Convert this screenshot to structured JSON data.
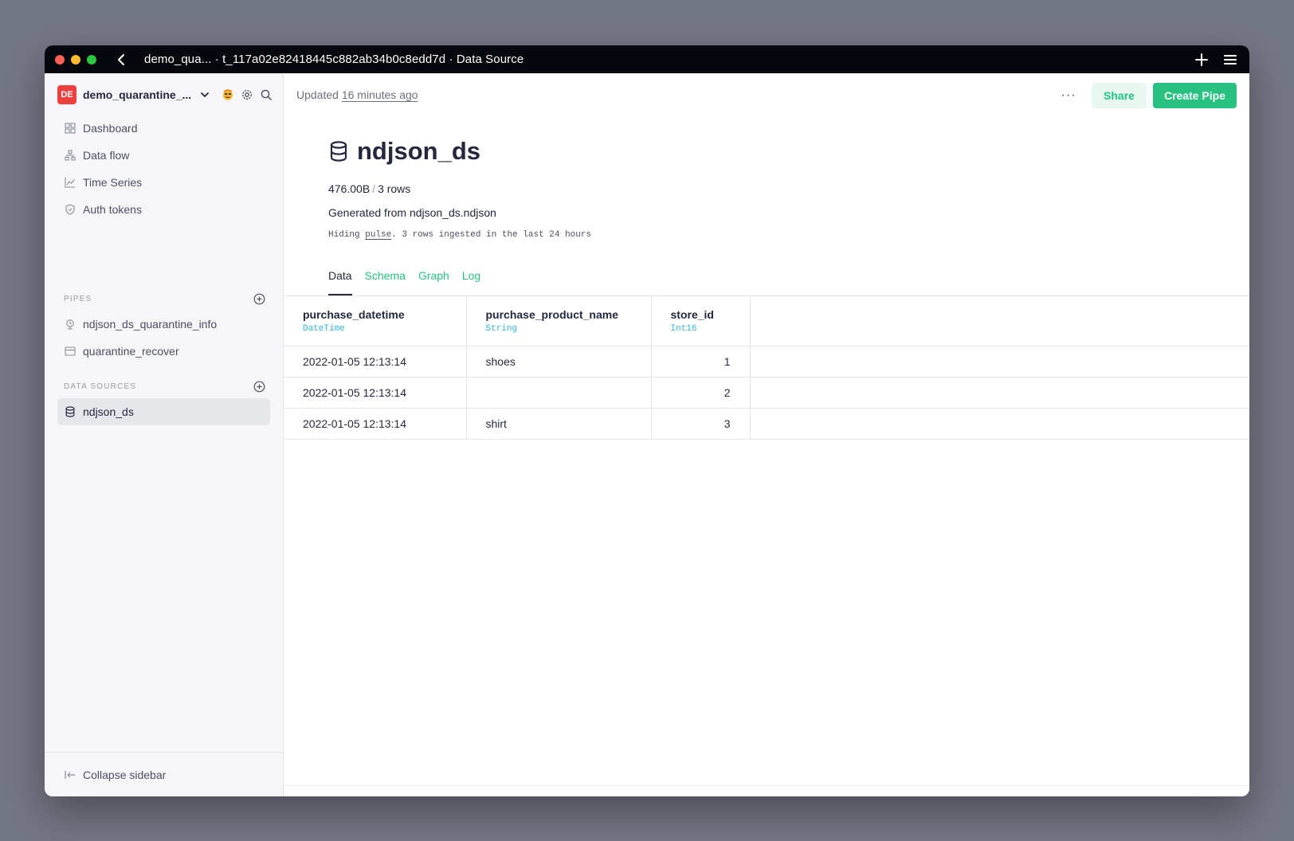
{
  "window": {
    "title": "demo_qua... · t_117a02e82418445c882ab34b0c8edd7d · Data Source"
  },
  "sidebar": {
    "workspace_badge": "DE",
    "workspace_name": "demo_quarantine_...",
    "nav": [
      {
        "label": "Dashboard",
        "icon": "dashboard-icon"
      },
      {
        "label": "Data flow",
        "icon": "data-flow-icon"
      },
      {
        "label": "Time Series",
        "icon": "chart-icon"
      },
      {
        "label": "Auth tokens",
        "icon": "shield-icon"
      }
    ],
    "pipes_heading": "PIPES",
    "pipes": [
      {
        "label": "ndjson_ds_quarantine_info",
        "icon": "pipe-endpoint-icon"
      },
      {
        "label": "quarantine_recover",
        "icon": "pipe-icon"
      }
    ],
    "datasources_heading": "DATA SOURCES",
    "datasources": [
      {
        "label": "ndjson_ds",
        "icon": "database-icon",
        "active": true
      }
    ],
    "collapse_label": "Collapse sidebar"
  },
  "header": {
    "updated_prefix": "Updated",
    "updated_time": "16 minutes ago",
    "more_label": "···",
    "share_label": "Share",
    "create_label": "Create Pipe"
  },
  "datasource": {
    "name": "ndjson_ds",
    "size": "476.00B",
    "rows": "3 rows",
    "description": "Generated from ndjson_ds.ndjson",
    "pulse_prefix": "Hiding",
    "pulse_link": "pulse",
    "pulse_suffix": ". 3 rows ingested in the last 24 hours"
  },
  "tabs": [
    "Data",
    "Schema",
    "Graph",
    "Log"
  ],
  "table": {
    "columns": [
      {
        "name": "purchase_datetime",
        "type": "DateTime"
      },
      {
        "name": "purchase_product_name",
        "type": "String"
      },
      {
        "name": "store_id",
        "type": "Int16"
      }
    ],
    "rows": [
      [
        "2022-01-05 12:13:14",
        "shoes",
        "1"
      ],
      [
        "2022-01-05 12:13:14",
        "",
        "2"
      ],
      [
        "2022-01-05 12:13:14",
        "shirt",
        "3"
      ]
    ]
  },
  "colors": {
    "accent": "#27c281",
    "type_label": "#2fb5e3",
    "workspace_badge": "#ef3f3f"
  }
}
